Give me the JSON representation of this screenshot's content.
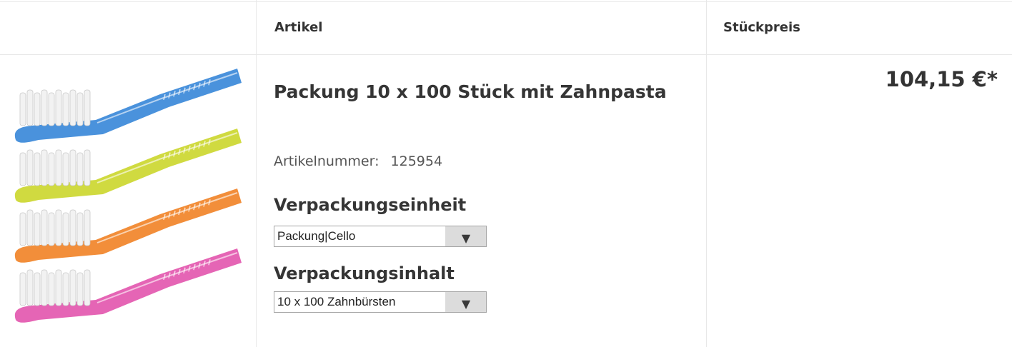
{
  "header": {
    "article": "Artikel",
    "unit_price": "Stückpreis"
  },
  "product": {
    "title": "Packung 10 x 100 Stück mit Zahnpasta",
    "article_number_label": "Artikelnummer:",
    "article_number": "125954",
    "image_icon": "toothbrush-image",
    "brush_colors": [
      "#2a7fd6",
      "#c8d41e",
      "#f07a18",
      "#e04aa8"
    ],
    "price": "104,15 €*"
  },
  "options": {
    "packaging_unit_label": "Verpackungseinheit",
    "packaging_unit_value": "Packung|Cello",
    "packaging_content_label": "Verpackungsinhalt",
    "packaging_content_value": "10 x 100 Zahnbürsten"
  }
}
